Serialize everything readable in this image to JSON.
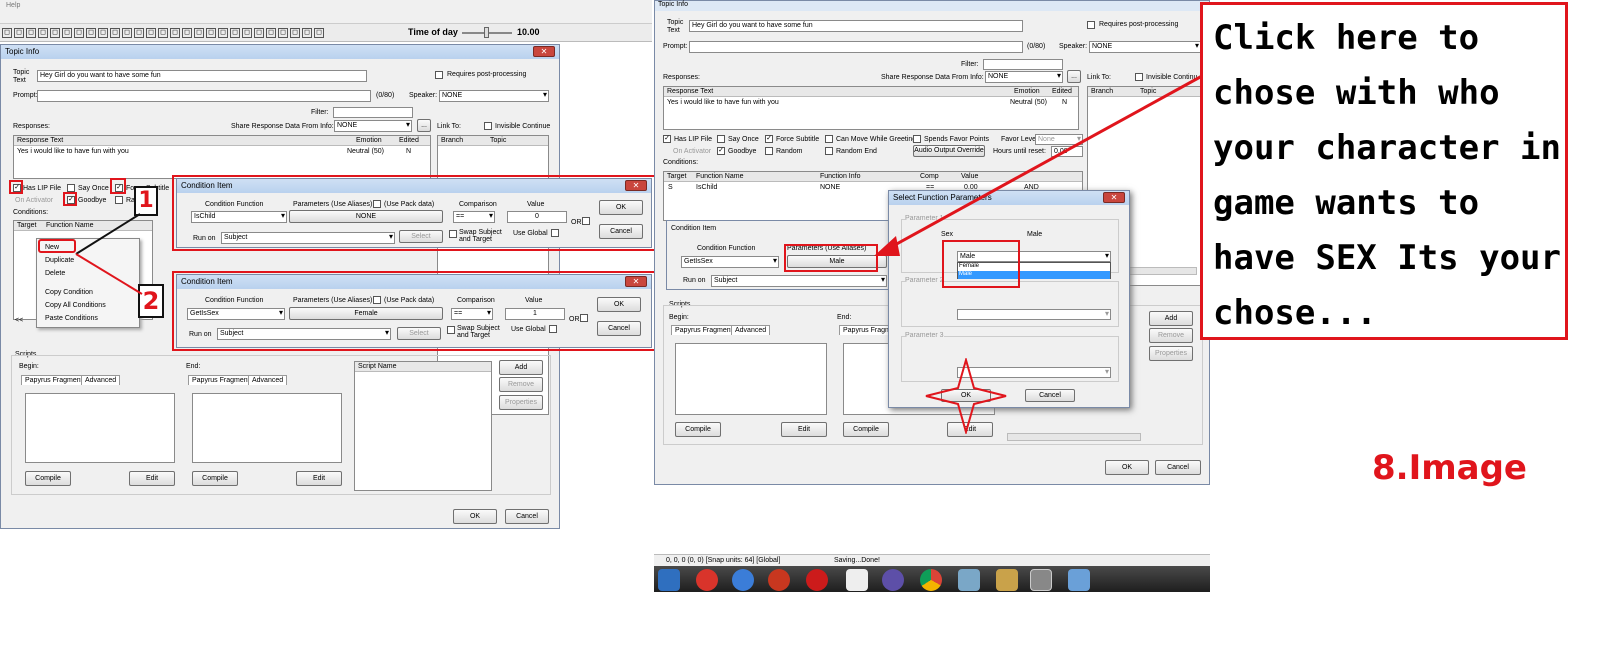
{
  "menu": {
    "help": "Help"
  },
  "toolbar": {
    "time_label": "Time of day",
    "time_value": "10.00"
  },
  "left": {
    "title": "Topic Info",
    "topic_text_label": "Topic\nText",
    "topic_text": "Hey Girl do you want to have some fun",
    "requires_post": "Requires post-processing",
    "prompt_label": "Prompt:",
    "prompt_count": "(0/80)",
    "speaker_label": "Speaker:",
    "speaker_value": "NONE",
    "filter_label": "Filter:",
    "responses_label": "Responses:",
    "share_label": "Share Response Data From Info:",
    "share_value": "NONE",
    "share_btn": "...",
    "link_to": "Link To:",
    "invisible": "Invisible Continue",
    "resp_cols": [
      "Response Text",
      "Emotion",
      "Edited"
    ],
    "resp_row": [
      "Yes i would like to have fun with you",
      "Neutral (50)",
      "N"
    ],
    "branch_cols": [
      "Branch",
      "Topic"
    ],
    "has_lip": "Has LIP File",
    "say_once": "Say Once",
    "force_sub": "Force Subtitle",
    "on_activator": "On Activator",
    "goodbye": "Goodbye",
    "random": "Random",
    "conditions_label": "Conditions:",
    "cond_cols": [
      "Target",
      "Function Name"
    ],
    "context_menu": [
      "New",
      "Duplicate",
      "Delete",
      "Copy Condition",
      "Copy All Conditions",
      "Paste Conditions"
    ],
    "nav_left": "<<",
    "scripts_label": "Scripts",
    "begin": "Begin:",
    "end": "End:",
    "papyrus": "Papyrus Fragment",
    "advanced": "Advanced",
    "compile": "Compile",
    "edit": "Edit",
    "script_name": "Script Name",
    "add": "Add",
    "remove": "Remove",
    "properties": "Properties",
    "ok": "OK",
    "cancel": "Cancel"
  },
  "cond1": {
    "title": "Condition Item",
    "func_label": "Condition Function",
    "func_value": "IsChild",
    "params_label": "Parameters (Use Aliases)",
    "use_pack": "(Use Pack data)",
    "param_value": "NONE",
    "comparison_label": "Comparison",
    "comparison_value": "==",
    "value_label": "Value",
    "value": "0",
    "or": "OR",
    "run_on_label": "Run on",
    "run_on_value": "Subject",
    "select": "Select",
    "swap": "Swap Subject\nand Target",
    "use_global": "Use Global",
    "ok": "OK",
    "cancel": "Cancel",
    "marker": "1"
  },
  "cond2": {
    "title": "Condition Item",
    "func_label": "Condition Function",
    "func_value": "GetIsSex",
    "params_label": "Parameters (Use Aliases)",
    "use_pack": "(Use Pack data)",
    "param_value": "Female",
    "comparison_label": "Comparison",
    "comparison_value": "==",
    "value_label": "Value",
    "value": "1",
    "or": "OR",
    "run_on_label": "Run on",
    "run_on_value": "Subject",
    "select": "Select",
    "swap": "Swap Subject\nand Target",
    "use_global": "Use Global",
    "ok": "OK",
    "cancel": "Cancel",
    "marker": "2"
  },
  "right": {
    "title": "Topic Info",
    "topic_text_label": "Topic\nText",
    "topic_text": "Hey Girl do you want to have some fun",
    "requires_post": "Requires post-processing",
    "prompt_label": "Prompt:",
    "prompt_count": "(0/80)",
    "speaker_label": "Speaker:",
    "speaker_value": "NONE",
    "filter_label": "Filter:",
    "responses_label": "Responses:",
    "share_label": "Share Response Data From Info:",
    "share_value": "NONE",
    "link_to": "Link To:",
    "invisible": "Invisible Continu",
    "resp_cols": [
      "Response Text",
      "Emotion",
      "Edited"
    ],
    "resp_row": [
      "Yes i would like to have fun with you",
      "Neutral (50)",
      "N"
    ],
    "branch_cols": [
      "Branch",
      "Topic"
    ],
    "has_lip": "Has LIP File",
    "say_once": "Say Once",
    "force_sub": "Force Subtitle",
    "can_move": "Can Move While Greeting",
    "spends_favor": "Spends Favor Points",
    "favor_level": "Favor Level:",
    "favor_value": "None",
    "on_activator": "On Activator",
    "goodbye": "Goodbye",
    "random": "Random",
    "random_end": "Random End",
    "audio_override": "Audio Output Override",
    "hours_reset": "Hours until reset:",
    "hours_value": "0.00",
    "conditions_label": "Conditions:",
    "cond_cols": [
      "Target",
      "Function Name",
      "Function Info",
      "Comp",
      "Value"
    ],
    "cond_row": [
      "S",
      "IsChild",
      "NONE",
      "==",
      "0.00",
      "AND"
    ],
    "cond_item_title": "Condition Item",
    "cond_func_label": "Condition Function",
    "cond_func_value": "GetIsSex",
    "cond_params_label": "Parameters (Use Aliases)",
    "cond_param_value": "Male",
    "run_on_label": "Run on",
    "run_on_value": "Subject",
    "scripts_label": "Scripts",
    "begin": "Begin:",
    "end": "End:",
    "papyrus": "Papyrus Fragment",
    "advanced": "Advanced",
    "compile": "Compile",
    "edit": "Edit",
    "add": "Add",
    "remove": "Remove",
    "properties": "Properties",
    "ok": "OK",
    "cancel": "Cancel",
    "status_coords": "0, 0, 0 (0, 0) [Snap units: 64] [Global]",
    "status_saving": "Saving...Done!"
  },
  "sfp": {
    "title": "Select Function Parameters",
    "param1": "Parameter 1",
    "param2": "Parameter 2",
    "param3": "Parameter 3",
    "sex_label": "Sex",
    "male_label": "Male",
    "combo_value": "Male",
    "options": [
      "Female",
      "Male"
    ],
    "ok": "OK",
    "cancel": "Cancel"
  },
  "annotation": {
    "text": "Click here to chose with who your character in game wants to have SEX Its your chose...",
    "image_label": "8.Image",
    "accent": "#e0151c"
  }
}
